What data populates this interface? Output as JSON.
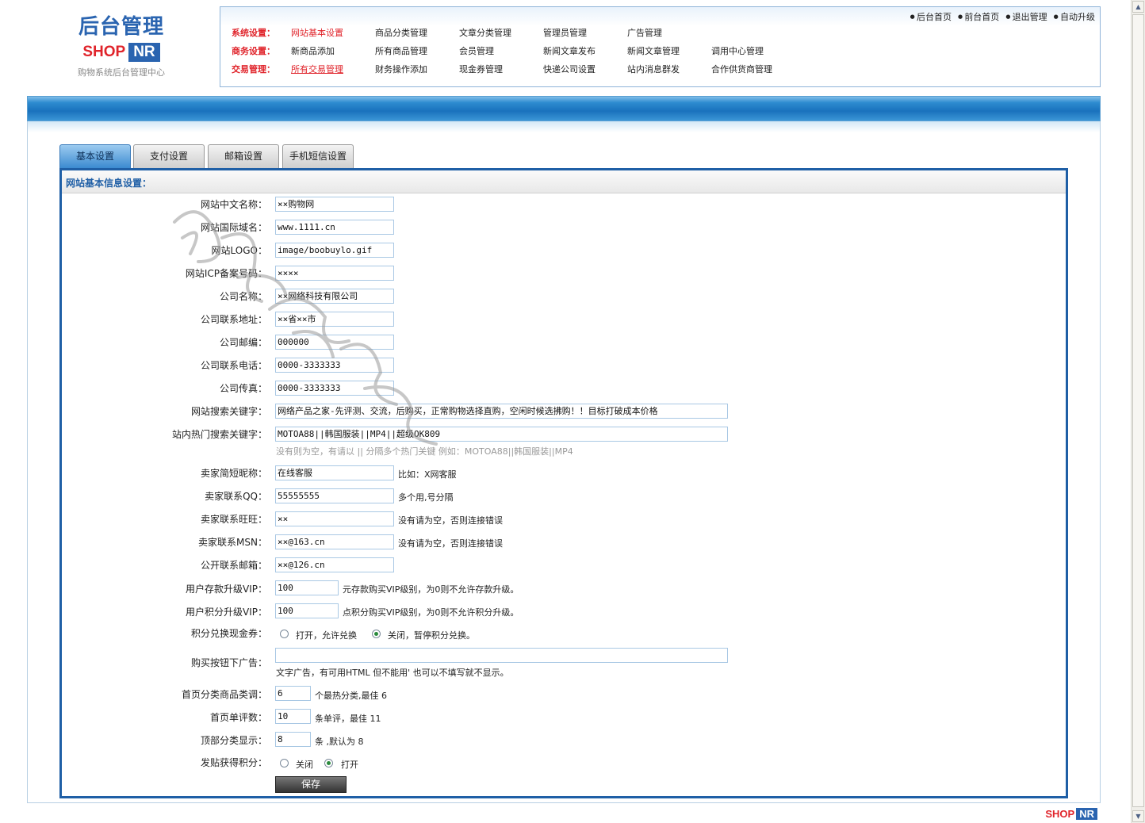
{
  "logo": {
    "title": "后台管理",
    "shop": "SHOP",
    "nr": "NR",
    "subtitle": "购物系统后台管理中心"
  },
  "toplinks": [
    "后台首页",
    "前台首页",
    "退出管理",
    "自动升级"
  ],
  "nav": {
    "system": {
      "label": "系统设置：",
      "items": [
        "网站基本设置",
        "商品分类管理",
        "文章分类管理",
        "管理员管理",
        "广告管理"
      ]
    },
    "business": {
      "label": "商务设置：",
      "items": [
        "新商品添加",
        "所有商品管理",
        "会员管理",
        "新闻文章发布",
        "新闻文章管理",
        "调用中心管理"
      ]
    },
    "trade": {
      "label": "交易管理：",
      "items": [
        "所有交易管理",
        "财务操作添加",
        "现金券管理",
        "快递公司设置",
        "站内消息群发",
        "合作供货商管理"
      ]
    }
  },
  "tabs": [
    "基本设置",
    "支付设置",
    "邮箱设置",
    "手机短信设置"
  ],
  "panel_title": "网站基本信息设置：",
  "fields": {
    "site_cn_name": {
      "label": "网站中文名称：",
      "value": "××购物网"
    },
    "site_domain": {
      "label": "网站国际域名：",
      "value": "www.1111.cn"
    },
    "site_logo": {
      "label": "网站LOGO：",
      "value": "image/boobuylo.gif"
    },
    "site_icp": {
      "label": "网站ICP备案号码：",
      "value": "××××"
    },
    "company_name": {
      "label": "公司名称：",
      "value": "××网络科技有限公司"
    },
    "company_address": {
      "label": "公司联系地址：",
      "value": "××省××市"
    },
    "company_zip": {
      "label": "公司邮编：",
      "value": "000000"
    },
    "company_phone": {
      "label": "公司联系电话：",
      "value": "0000-3333333"
    },
    "company_fax": {
      "label": "公司传真：",
      "value": "0000-3333333"
    },
    "search_keywords": {
      "label": "网站搜索关键字：",
      "value": "网络产品之家-先评测、交流，后购买，正常购物选择直购，空闲时候选拂购！！目标打破成本价格"
    },
    "hot_keywords": {
      "label": "站内热门搜索关键字：",
      "value": "MOTOA88||韩国服装||MP4||超级OK809",
      "hint": "没有则为空，有请以 || 分隔多个热门关键 例如：MOTOA88||韩国服装||MP4"
    },
    "seller_nick": {
      "label": "卖家简短昵称：",
      "value": "在线客服",
      "hint": "比如：X网客服"
    },
    "seller_qq": {
      "label": "卖家联系QQ：",
      "value": "55555555",
      "hint": "多个用,号分隔"
    },
    "seller_wangwang": {
      "label": "卖家联系旺旺：",
      "value": "××",
      "hint": "没有请为空，否则连接错误"
    },
    "seller_msn": {
      "label": "卖家联系MSN：",
      "value": "××@163.cn",
      "hint": "没有请为空，否则连接错误"
    },
    "public_email": {
      "label": "公开联系邮箱：",
      "value": "××@126.cn"
    },
    "vip_deposit": {
      "label": "用户存款升级VIP：",
      "value": "100",
      "hint": "元存款购买VIP级别，为0则不允许存款升级。"
    },
    "vip_points": {
      "label": "用户积分升级VIP：",
      "value": "100",
      "hint": "点积分购买VIP级别，为0则不允许积分升级。"
    },
    "points_coupon": {
      "label": "积分兑换现金券：",
      "opt_on": "打开，允许兑换",
      "opt_off": "关闭，暂停积分兑换。",
      "selected": "off"
    },
    "buy_ad": {
      "label": "购买按钮下广告：",
      "value": "",
      "hint": "文字广告，有可用HTML 但不能用' 也可以不填写就不显示。"
    },
    "home_cat_goods": {
      "label": "首页分类商品类调：",
      "value": "6",
      "hint": "个最热分类,最佳 6"
    },
    "home_reviews": {
      "label": "首页单评数：",
      "value": "10",
      "hint": "条单评，最佳 11"
    },
    "top_cat_show": {
      "label": "顶部分类显示：",
      "value": "8",
      "hint": "条 ,默认为 8"
    },
    "post_points": {
      "label": "发贴获得积分：",
      "opt_off": "关闭",
      "opt_on": "打开",
      "selected": "on"
    }
  },
  "save_label": "保存",
  "footer": {
    "shop": "SHOP",
    "nr": "NR"
  },
  "colors": {
    "accent": "#1f5fa6",
    "nav_label": "#e0242b",
    "banner": "#1a72bd"
  }
}
